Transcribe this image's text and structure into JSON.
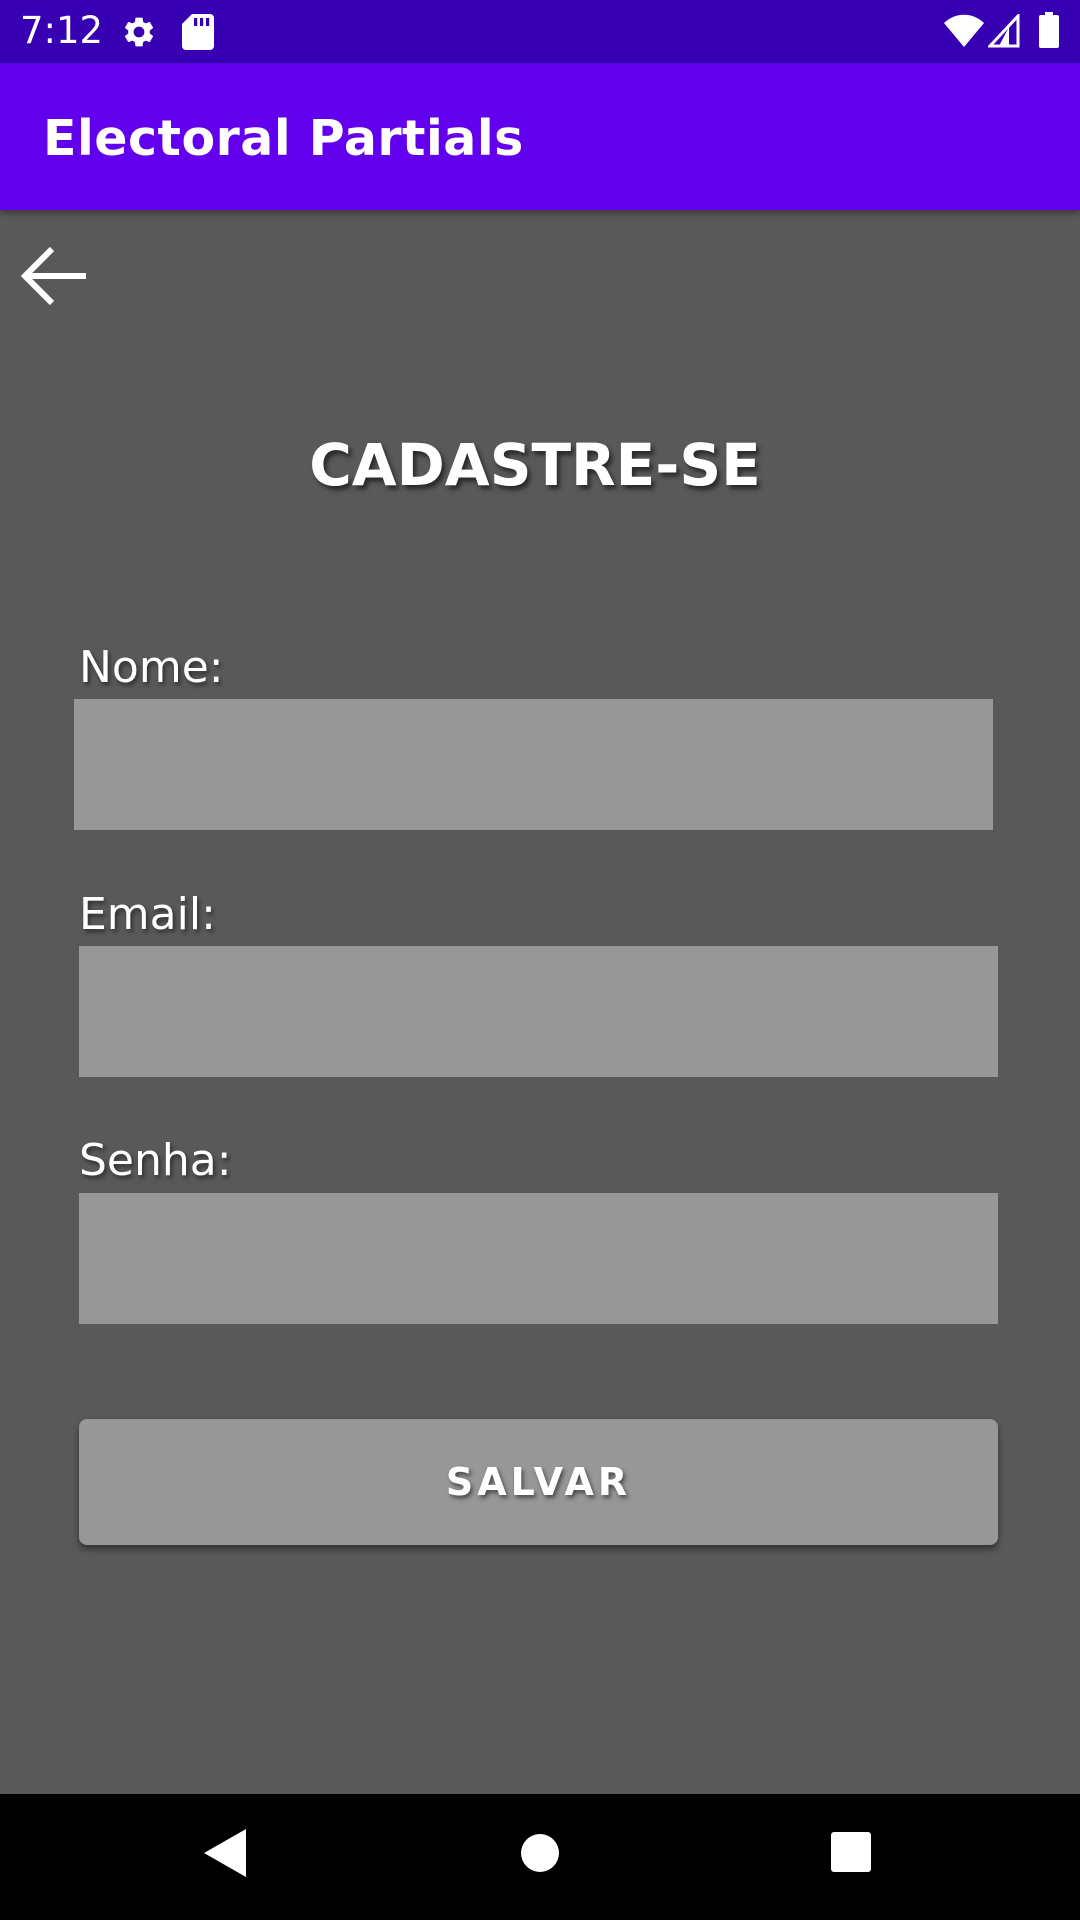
{
  "status_bar": {
    "time": "7:12",
    "icons": [
      "settings-icon",
      "sd-card-icon",
      "wifi-icon",
      "signal-icon",
      "battery-icon"
    ]
  },
  "app_bar": {
    "title": "Electoral Partials",
    "color": "#6200EE",
    "status_color": "#3700B3"
  },
  "back_button": {
    "icon": "arrow-back-icon"
  },
  "form": {
    "heading": "CADASTRE-SE",
    "fields": [
      {
        "label": "Nome:",
        "value": "",
        "placeholder": ""
      },
      {
        "label": "Email:",
        "value": "",
        "placeholder": ""
      },
      {
        "label": "Senha:",
        "value": "",
        "placeholder": ""
      }
    ],
    "submit_label": "SALVAR"
  },
  "nav_bar": {
    "icons": [
      "back-triangle-icon",
      "home-circle-icon",
      "recents-square-icon"
    ]
  },
  "colors": {
    "background": "#595959",
    "input_fill": "#979797",
    "text": "#FFFFFF"
  }
}
